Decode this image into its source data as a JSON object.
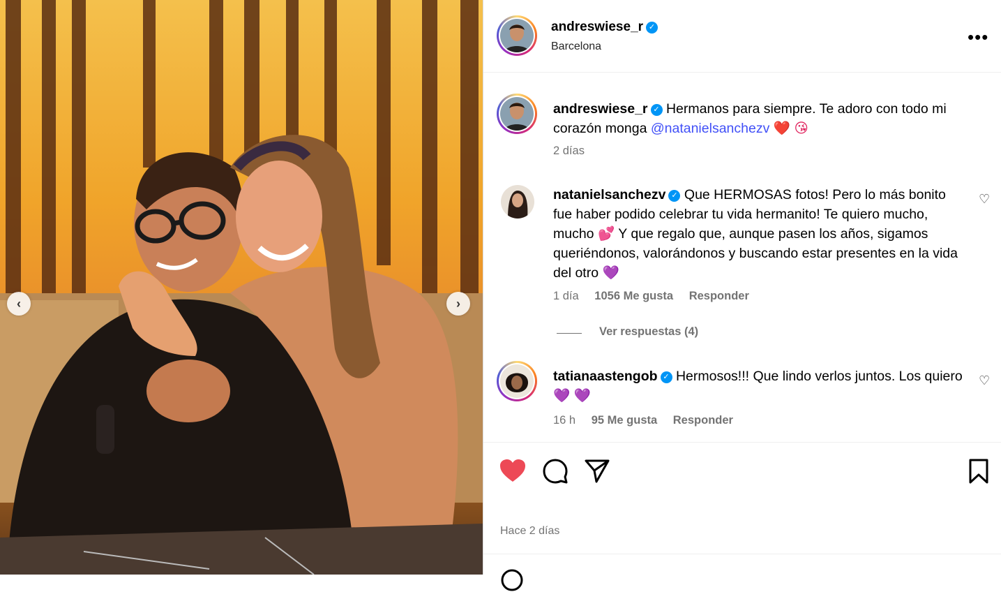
{
  "post": {
    "username": "andreswiese_r",
    "location": "Barcelona",
    "more_label": "•••",
    "prev_arrow": "‹",
    "next_arrow": "›"
  },
  "caption": {
    "username": "andreswiese_r",
    "text": "Hermanos para siempre. Te adoro con todo mi corazón monga",
    "mention": "@nataniel­sanchezv",
    "emoji": "❤️ 😘",
    "time": "2 días"
  },
  "comments": [
    {
      "username": "natanielsanchezv",
      "text": "Que HERMOSAS fotos! Pero lo más bonito fue haber podido celebrar tu vida hermanito! Te quiero mucho, mucho 💕 Y que regalo que, aunque pasen los años, sigamos queriéndonos, valorándonos y buscando estar presentes en la vida del otro 💜",
      "time": "1 día",
      "likes": "1056 Me gusta",
      "reply": "Responder",
      "view_replies": "Ver respuestas (4)"
    },
    {
      "username": "tatianaastengob",
      "text": "Hermosos!!! Que lindo verlos juntos. Los quiero 💜 💜",
      "time": "16 h",
      "likes": "95 Me gusta",
      "reply": "Responder"
    }
  ],
  "footer": {
    "time_ago": "Hace 2 días"
  },
  "colors": {
    "link": "#4150f7",
    "verified": "#0095f6",
    "like_active": "#ed4956",
    "muted": "#737373"
  },
  "icons": [
    "heart-icon",
    "comment-icon",
    "share-icon",
    "bookmark-icon",
    "more-icon",
    "verified-icon"
  ]
}
